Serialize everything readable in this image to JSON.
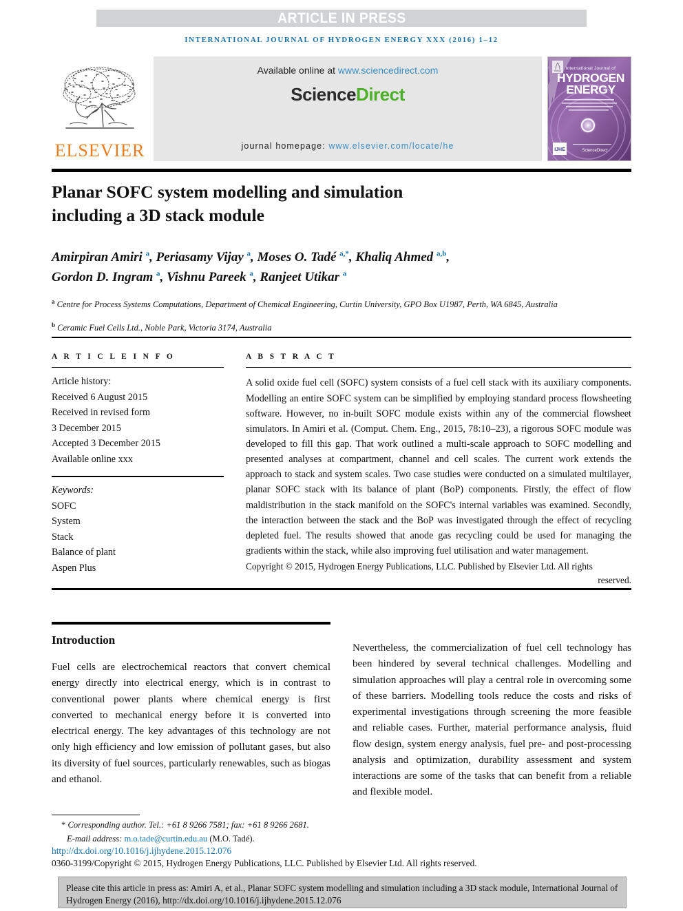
{
  "banner": {
    "text": "ARTICLE IN PRESS"
  },
  "running_head": "INTERNATIONAL JOURNAL OF HYDROGEN ENERGY XXX (2016) 1–12",
  "masthead": {
    "publisher": "ELSEVIER",
    "available_prefix": "Available online at ",
    "available_url": "www.sciencedirect.com",
    "sciencedirect_part1": "Science",
    "sciencedirect_part2": "Direct",
    "homepage_prefix": "journal homepage: ",
    "homepage_url": "www.elsevier.com/locate/he",
    "cover": {
      "line1": "International Journal of",
      "line2": "HYDROGEN",
      "line3": "ENERGY",
      "badge": "IJHE",
      "footer_mark": "ScienceDirect"
    }
  },
  "article": {
    "title_line1": "Planar SOFC system modelling and simulation",
    "title_line2": "including a 3D stack module",
    "authors_line1": "Amirpiran Amiri <sup>a</sup>, Periasamy Vijay <sup>a</sup>, Moses O. Tadé <sup>a,*</sup>, Khaliq Ahmed <sup>a,b</sup>,",
    "authors_line2": "Gordon D. Ingram <sup>a</sup>, Vishnu Pareek <sup>a</sup>, Ranjeet Utikar <sup>a</sup>",
    "affiliation_a": "<sup>a</sup> Centre for Process Systems Computations, Department of Chemical Engineering, Curtin University, GPO Box U1987, Perth, WA 6845, Australia",
    "affiliation_b": "<sup>b</sup> Ceramic Fuel Cells Ltd., Noble Park, Victoria 3174, Australia"
  },
  "article_info": {
    "heading": "A R T I C L E   I N F O",
    "history_label": "Article history:",
    "history": [
      "Received 6 August 2015",
      "Received in revised form",
      "3 December 2015",
      "Accepted 3 December 2015",
      "Available online xxx"
    ],
    "keywords_label": "Keywords:",
    "keywords": [
      "SOFC",
      "System",
      "Stack",
      "Balance of plant",
      "Aspen Plus"
    ]
  },
  "abstract": {
    "heading": "A B S T R A C T",
    "body": "A solid oxide fuel cell (SOFC) system consists of a fuel cell stack with its auxiliary components. Modelling an entire SOFC system can be simplified by employing standard process flowsheeting software. However, no in-built SOFC module exists within any of the commercial flowsheet simulators. In Amiri et al. (Comput. Chem. Eng., 2015, 78:10–23), a rigorous SOFC module was developed to fill this gap. That work outlined a multi-scale approach to SOFC modelling and presented analyses at compartment, channel and cell scales. The current work extends the approach to stack and system scales. Two case studies were conducted on a simulated multilayer, planar SOFC stack with its balance of plant (BoP) components. Firstly, the effect of flow maldistribution in the stack manifold on the SOFC's internal variables was examined. Secondly, the interaction between the stack and the BoP was investigated through the effect of recycling depleted fuel. The results showed that anode gas recycling could be used for managing the gradients within the stack, while also improving fuel utilisation and water management.",
    "copyright": "Copyright © 2015, Hydrogen Energy Publications, LLC. Published by Elsevier Ltd. All rights",
    "copyright_last": "reserved."
  },
  "introduction": {
    "heading": "Introduction",
    "paragraph_left": "Fuel cells are electrochemical reactors that convert chemical energy directly into electrical energy, which is in contrast to conventional power plants where chemical energy is first converted to mechanical energy before it is converted into electrical energy. The key advantages of this technology are not only high efficiency and low emission of pollutant gases, but also its diversity of fuel sources, particularly renewables, such as biogas and ethanol.",
    "paragraph_right": "Nevertheless, the commercialization of fuel cell technology has been hindered by several technical challenges. Modelling and simulation approaches will play a central role in overcoming some of these barriers. Modelling tools reduce the costs and risks of experimental investigations through screening the more feasible and reliable cases. Further, material performance analysis, fluid flow design, system energy analysis, fuel pre- and post-processing analysis and optimization, durability assessment and system interactions are some of the tasks that can benefit from a reliable and flexible model."
  },
  "footer": {
    "corresponding_marker": "*",
    "corresponding_text": "Corresponding author. Tel.: +61 8 9266 7581; fax: +61 8 9266 2681.",
    "email_label": "E-mail address: ",
    "email": "m.o.tade@curtin.edu.au",
    "email_suffix": " (M.O. Tadé).",
    "doi": "http://dx.doi.org/10.1016/j.ijhydene.2015.12.076",
    "issn_copyright": "0360-3199/Copyright © 2015, Hydrogen Energy Publications, LLC. Published by Elsevier Ltd. All rights reserved."
  },
  "citation_box": {
    "text": "Please cite this article in press as: Amiri A, et al., Planar SOFC system modelling and simulation including a 3D stack module, International Journal of Hydrogen Energy (2016), http://dx.doi.org/10.1016/j.ijhydene.2015.12.076"
  },
  "colors": {
    "banner_bg": "#d0d2d4",
    "link_blue": "#1670a6",
    "sd_green": "#4caf28",
    "elsevier_orange": "#e87d1e",
    "sd_box_bg": "#e6e6e6",
    "cite_box_bg": "#c9c9c9"
  }
}
